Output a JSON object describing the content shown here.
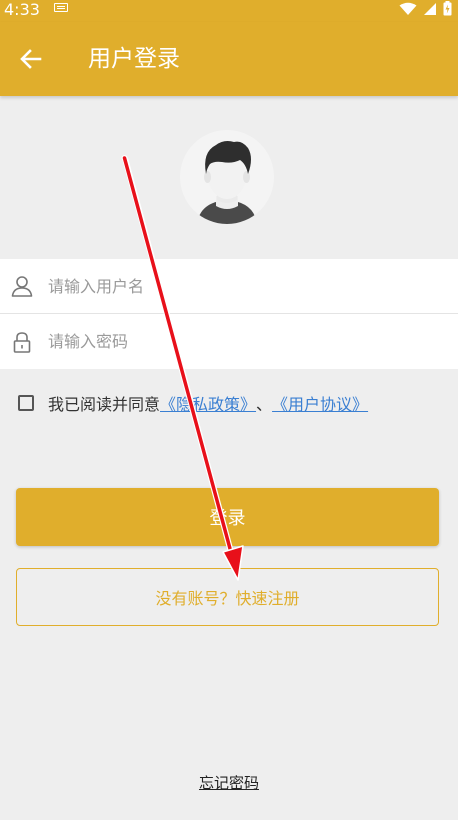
{
  "status_bar": {
    "time": "4:33",
    "icons": [
      "keyboard-icon",
      "wifi-icon",
      "signal-icon",
      "battery-icon"
    ]
  },
  "app_bar": {
    "title": "用户登录",
    "back_icon": "arrow-left-icon"
  },
  "avatar": {
    "icon": "avatar-icon"
  },
  "form": {
    "username_placeholder": "请输入用户名",
    "username_value": "",
    "password_placeholder": "请输入密码",
    "password_value": ""
  },
  "agreement": {
    "prefix": "我已阅读并同意",
    "privacy_link": "《隐私政策》",
    "separator": "、",
    "user_agreement_link": "《用户协议》",
    "checked": false
  },
  "buttons": {
    "login": "登录",
    "register": "没有账号？快速注册",
    "forgot_password": "忘记密码"
  },
  "colors": {
    "accent": "#e0ae2c",
    "link": "#3a7fd2",
    "background": "#eeeeee",
    "annotation_arrow": "#e8101a"
  }
}
